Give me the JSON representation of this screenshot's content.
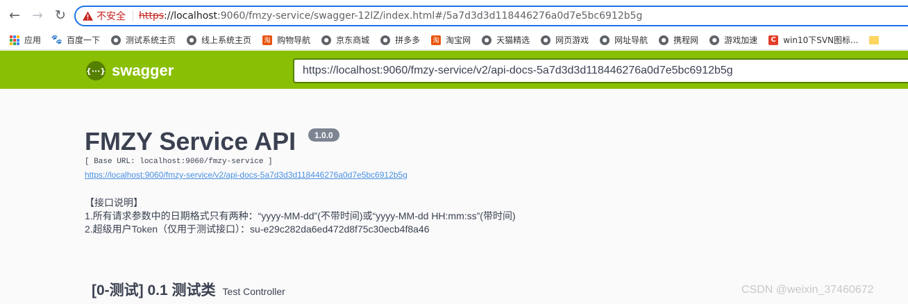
{
  "browser": {
    "insecure_label": "不安全",
    "url_scheme": "https",
    "url_host": "://localhost",
    "url_rest": ":9060/fmzy-service/swagger-12lZ/index.html#/5a7d3d3d118446276a0d7e5bc6912b5g",
    "bookmarks": [
      {
        "label": "应用",
        "icon": "apps-grid-icon"
      },
      {
        "label": "百度一下",
        "icon": "baidu-paw-icon"
      },
      {
        "label": "测试系统主页",
        "icon": "globe-icon"
      },
      {
        "label": "线上系统主页",
        "icon": "globe-icon"
      },
      {
        "label": "购物导航",
        "icon": "taobao-icon"
      },
      {
        "label": "京东商城",
        "icon": "globe-icon"
      },
      {
        "label": "拼多多",
        "icon": "globe-icon"
      },
      {
        "label": "淘宝网",
        "icon": "taobao-icon"
      },
      {
        "label": "天猫精选",
        "icon": "globe-icon"
      },
      {
        "label": "网页游戏",
        "icon": "globe-icon"
      },
      {
        "label": "网址导航",
        "icon": "globe-icon"
      },
      {
        "label": "携程网",
        "icon": "globe-icon"
      },
      {
        "label": "游戏加速",
        "icon": "globe-icon"
      },
      {
        "label": "win10下SVN图标...",
        "icon": "csdn-c-icon"
      }
    ]
  },
  "swagger": {
    "brand": "swagger",
    "logo_glyph": "{···}",
    "spec_url": "https://localhost:9060/fmzy-service/v2/api-docs-5a7d3d3d118446276a0d7e5bc6912b5g",
    "accent_color": "#89bf04"
  },
  "info": {
    "title": "FMZY Service API",
    "version": "1.0.0",
    "base_url": "[ Base URL: localhost:9060/fmzy-service ]",
    "spec_link": "https://localhost:9060/fmzy-service/v2/api-docs-5a7d3d3d118446276a0d7e5bc6912b5g",
    "description": [
      "【接口说明】",
      "1.所有请求参数中的日期格式只有两种：“yyyy-MM-dd”(不带时间)或“yyyy-MM-dd HH:mm:ss”(带时间)",
      "2.超级用户Token（仅用于测试接口）：su-e29c282da6ed472d8f75c30ecb4f8a46"
    ]
  },
  "tag": {
    "name": "[0-测试] 0.1 测试类",
    "description": "Test Controller"
  },
  "watermark": "CSDN @weixin_37460672"
}
